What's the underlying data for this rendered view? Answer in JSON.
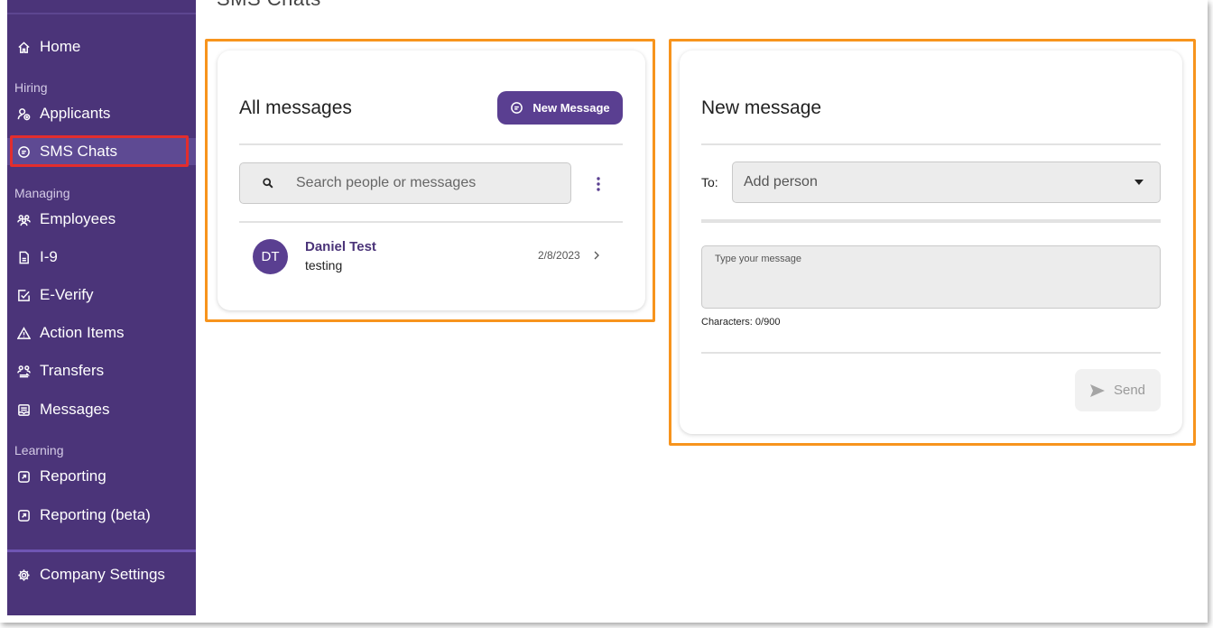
{
  "page": {
    "title": "SMS Chats"
  },
  "sidebar": {
    "items": [
      {
        "id": "home",
        "label": "Home",
        "icon": "home-icon"
      },
      {
        "id": "applicants",
        "label": "Applicants",
        "icon": "applicants-icon"
      },
      {
        "id": "sms-chats",
        "label": "SMS Chats",
        "icon": "chat-bubble-icon",
        "active": true
      },
      {
        "id": "employees",
        "label": "Employees",
        "icon": "employees-icon"
      },
      {
        "id": "i9",
        "label": "I-9",
        "icon": "document-icon"
      },
      {
        "id": "e-verify",
        "label": "E-Verify",
        "icon": "checkbox-icon"
      },
      {
        "id": "action-items",
        "label": "Action Items",
        "icon": "warning-icon"
      },
      {
        "id": "transfers",
        "label": "Transfers",
        "icon": "transfers-icon"
      },
      {
        "id": "messages",
        "label": "Messages",
        "icon": "messages-icon"
      },
      {
        "id": "reporting",
        "label": "Reporting",
        "icon": "reporting-icon"
      },
      {
        "id": "reporting-beta",
        "label": "Reporting (beta)",
        "icon": "reporting-icon"
      },
      {
        "id": "company-settings",
        "label": "Company Settings",
        "icon": "gear-icon"
      }
    ],
    "sections": {
      "hiring": "Hiring",
      "managing": "Managing",
      "learning": "Learning"
    }
  },
  "all_messages": {
    "title": "All messages",
    "new_message_label": "New Message",
    "search_placeholder": "Search people or messages",
    "conversations": [
      {
        "initials": "DT",
        "name": "Daniel Test",
        "snippet": "testing",
        "date": "2/8/2023"
      }
    ]
  },
  "new_message": {
    "title": "New message",
    "to_label": "To:",
    "to_placeholder": "Add person",
    "message_placeholder": "Type your message",
    "char_count": "Characters: 0/900",
    "send_label": "Send"
  },
  "colors": {
    "sidebar_bg": "#4b3479",
    "accent": "#5a3f91",
    "highlight_orange": "#f7941d",
    "highlight_red": "#e32d2d"
  }
}
